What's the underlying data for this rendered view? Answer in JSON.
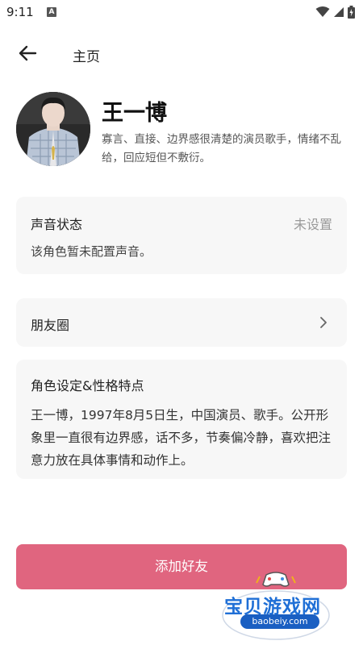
{
  "status_bar": {
    "time": "9:11",
    "notification_icon": "A"
  },
  "header": {
    "title": "主页"
  },
  "profile": {
    "name": "王一博",
    "bio": "寡言、直接、边界感很清楚的演员歌手，情绪不乱给，回应短但不敷衍。"
  },
  "voice": {
    "title": "声音状态",
    "status": "未设置",
    "description": "该角色暂未配置声音。"
  },
  "moments": {
    "label": "朋友圈"
  },
  "persona": {
    "title": "角色设定&性格特点",
    "text": "王一博，1997年8月5日生，中国演员、歌手。公开形象里一直很有边界感，话不多，节奏偏冷静，喜欢把注意力放在具体事情和动作上。"
  },
  "actions": {
    "add_friend_label": "添加好友"
  },
  "watermark": {
    "title": "宝贝游戏网",
    "url": "baobeiy.com"
  },
  "colors": {
    "accent": "#e0657f",
    "card_bg": "#f7f7f7",
    "watermark_blue": "#1f6fd6"
  }
}
